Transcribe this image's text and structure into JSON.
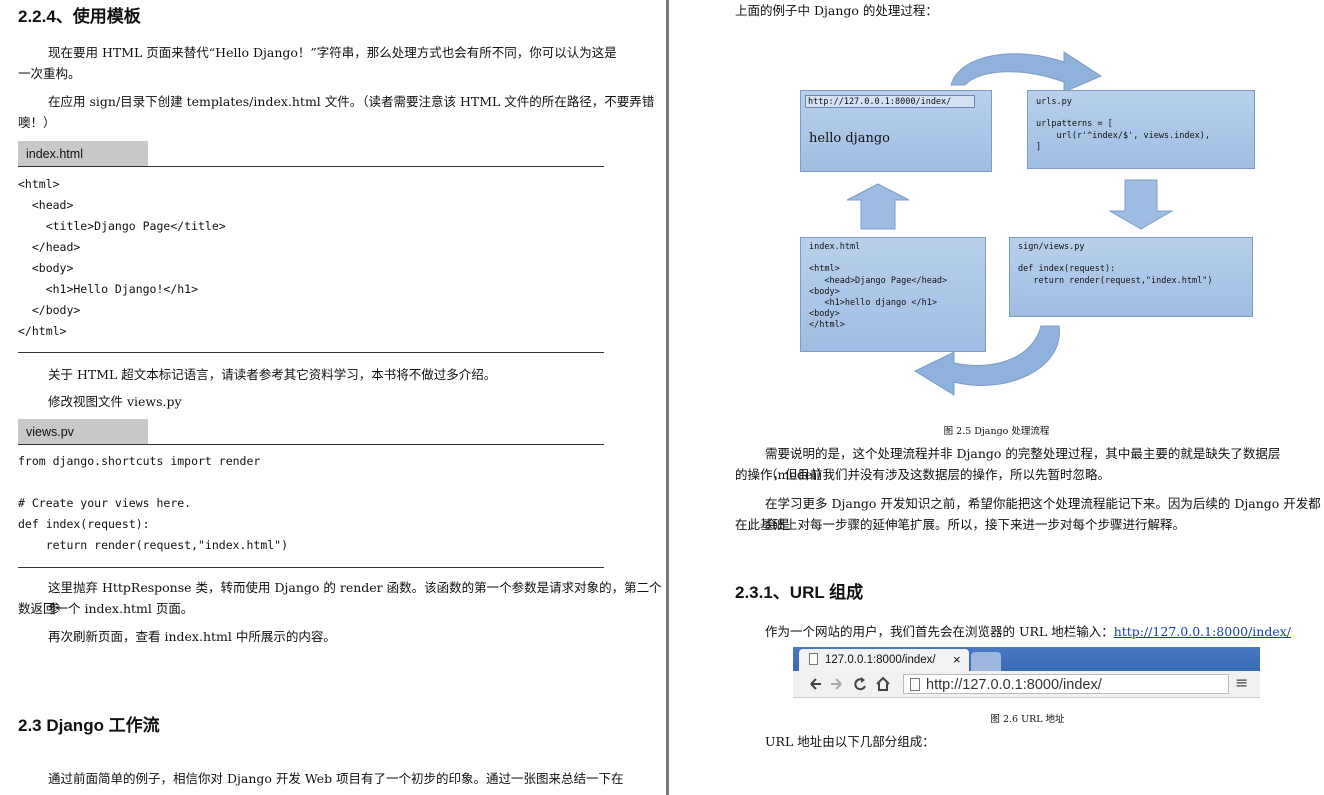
{
  "left_page": {
    "heading_224": "2.2.4、使用模板",
    "para1_line1": "现在要用 HTML 页面来替代“Hello Django！”字符串，那么处理方式也会有所不同，你可以认为这是",
    "para1_line2": "一次重构。",
    "para2_line1": "在应用 sign/目录下创建 templates/index.html 文件。（读者需要注意该 HTML 文件的所在路径，不要弄错",
    "para2_line2": "噢！）",
    "code1_tab": "index.html",
    "code1": "<html>\n  <head>\n    <title>Django Page</title>\n  </head>\n  <body>\n    <h1>Hello Django!</h1>\n  </body>\n</html>",
    "para3": "关于 HTML 超文本标记语言，请读者参考其它资料学习，本书将不做过多介绍。",
    "para4": "修改视图文件 views.py",
    "code2_tab": "views.pv",
    "code2": "from django.shortcuts import render\n\n# Create your views here.\ndef index(request):\n    return render(request,\"index.html\")",
    "para5_line1": "这里抛弃 HttpResponse 类，转而使用 Django 的 render 函数。该函数的第一个参数是请求对象的，第二个参",
    "para5_line2": "数返回一个 index.html 页面。",
    "para6": "再次刷新页面，查看 index.html 中所展示的内容。",
    "heading_23": "2.3  Django 工作流",
    "para7": "通过前面简单的例子，相信你对 Django 开发 Web 项目有了一个初步的印象。通过一张图来总结一下在"
  },
  "right_page": {
    "intro": "上面的例子中 Django 的处理过程：",
    "diagram": {
      "browser_url": "http://127.0.0.1:8000/index/",
      "browser_text": "hello django",
      "urls_code": "urls.py\n\nurlpatterns = [\n    url(r'^index/$', views.index),\n]",
      "index_code": "index.html\n\n<html>\n   <head>Django Page</head>\n<body>\n   <h1>hello django </h1>\n<body>\n</html>",
      "views_code": "sign/views.py\n\ndef index(request):\n   return render(request,\"index.html\")",
      "colors": {
        "note": "#a9c4e6",
        "arrow": "#8fb2dc"
      }
    },
    "fig25_caption": "图 2.5   Django 处理流程",
    "para1_line1": "需要说明的是，这个处理流程并非 Django 的完整处理过程，其中最主要的就是缺失了数据层（model）",
    "para1_line2": "的操作，但目前我们并没有涉及这数据层的操作，所以先暂时忽略。",
    "para2_line1": "在学习更多 Django 开发知识之前，希望你能把这个处理流程能记下来。因为后续的 Django 开发都会是",
    "para2_line2": "在此基础上对每一步骤的延伸笔扩展。所以，接下来进一步对每个步骤进行解释。",
    "heading_231": "2.3.1、URL 组成",
    "para3_prefix": "作为一个网站的用户，我们首先会在浏览器的 URL 地栏输入：",
    "para3_link": "http://127.0.0.1:8000/index/",
    "browser": {
      "tab_title": "127.0.0.1:8000/index/",
      "tab_close": "×",
      "url": "http://127.0.0.1:8000/index/",
      "menu_icon": "≡"
    },
    "fig26_caption": "图 2.6   URL 地址",
    "para4": "URL 地址由以下几部分组成："
  }
}
